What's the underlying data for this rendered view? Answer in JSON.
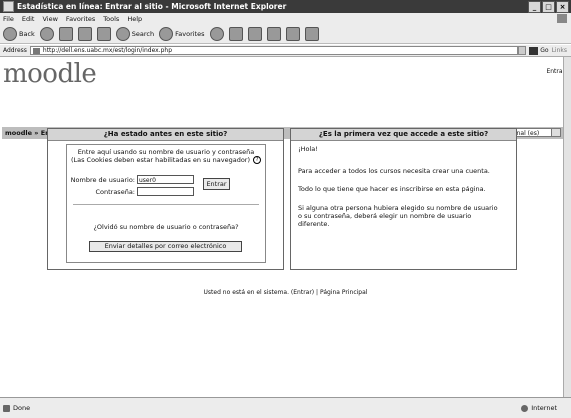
{
  "window": {
    "title": "Estadística en línea: Entrar al sitio - Microsoft Internet Explorer",
    "controls": [
      "_",
      "□",
      "×"
    ]
  },
  "menu": [
    "File",
    "Edit",
    "View",
    "Favorites",
    "Tools",
    "Help"
  ],
  "toolbar": {
    "back": "Back",
    "search": "Search",
    "favorites": "Favorites"
  },
  "address": {
    "label": "Address",
    "url": "http://dell.ens.uabc.mx/est/login/index.php",
    "go": "Go",
    "links": "Links"
  },
  "page": {
    "logo": "moodle",
    "login_link": "Entrar",
    "breadcrumb": "moodle » Entrar al sitio",
    "language": "Español - Internacional (es)"
  },
  "login_panel": {
    "heading": "¿Ha estado antes en este sitio?",
    "intro_line1": "Entre aquí usando su nombre de usuario y contraseña",
    "intro_line2": "(Las Cookies deben estar habilitadas en su navegador)",
    "help_icon": "?",
    "username_label": "Nombre de usuario:",
    "username_value": "user0",
    "password_label": "Contraseña:",
    "password_value": "",
    "submit_label": "Entrar",
    "forgot_text": "¿Olvidó su nombre de usuario o contraseña?",
    "send_button": "Enviar detalles por correo electrónico"
  },
  "signup_panel": {
    "heading": "¿Es la primera vez que accede a este sitio?",
    "greeting": "¡Hola!",
    "para1": "Para acceder a todos los cursos necesita crear una cuenta.",
    "para2": "Todo lo que tiene que hacer es inscribirse en esta página.",
    "para3": "Si alguna otra persona hubiera elegido su nombre de usuario o su contraseña, deberá elegir un nombre de usuario diferente."
  },
  "footer": {
    "text": "Usted no está en el sistema. (Entrar) | Página Principal"
  },
  "status": {
    "left": "Done",
    "zone": "Internet"
  }
}
